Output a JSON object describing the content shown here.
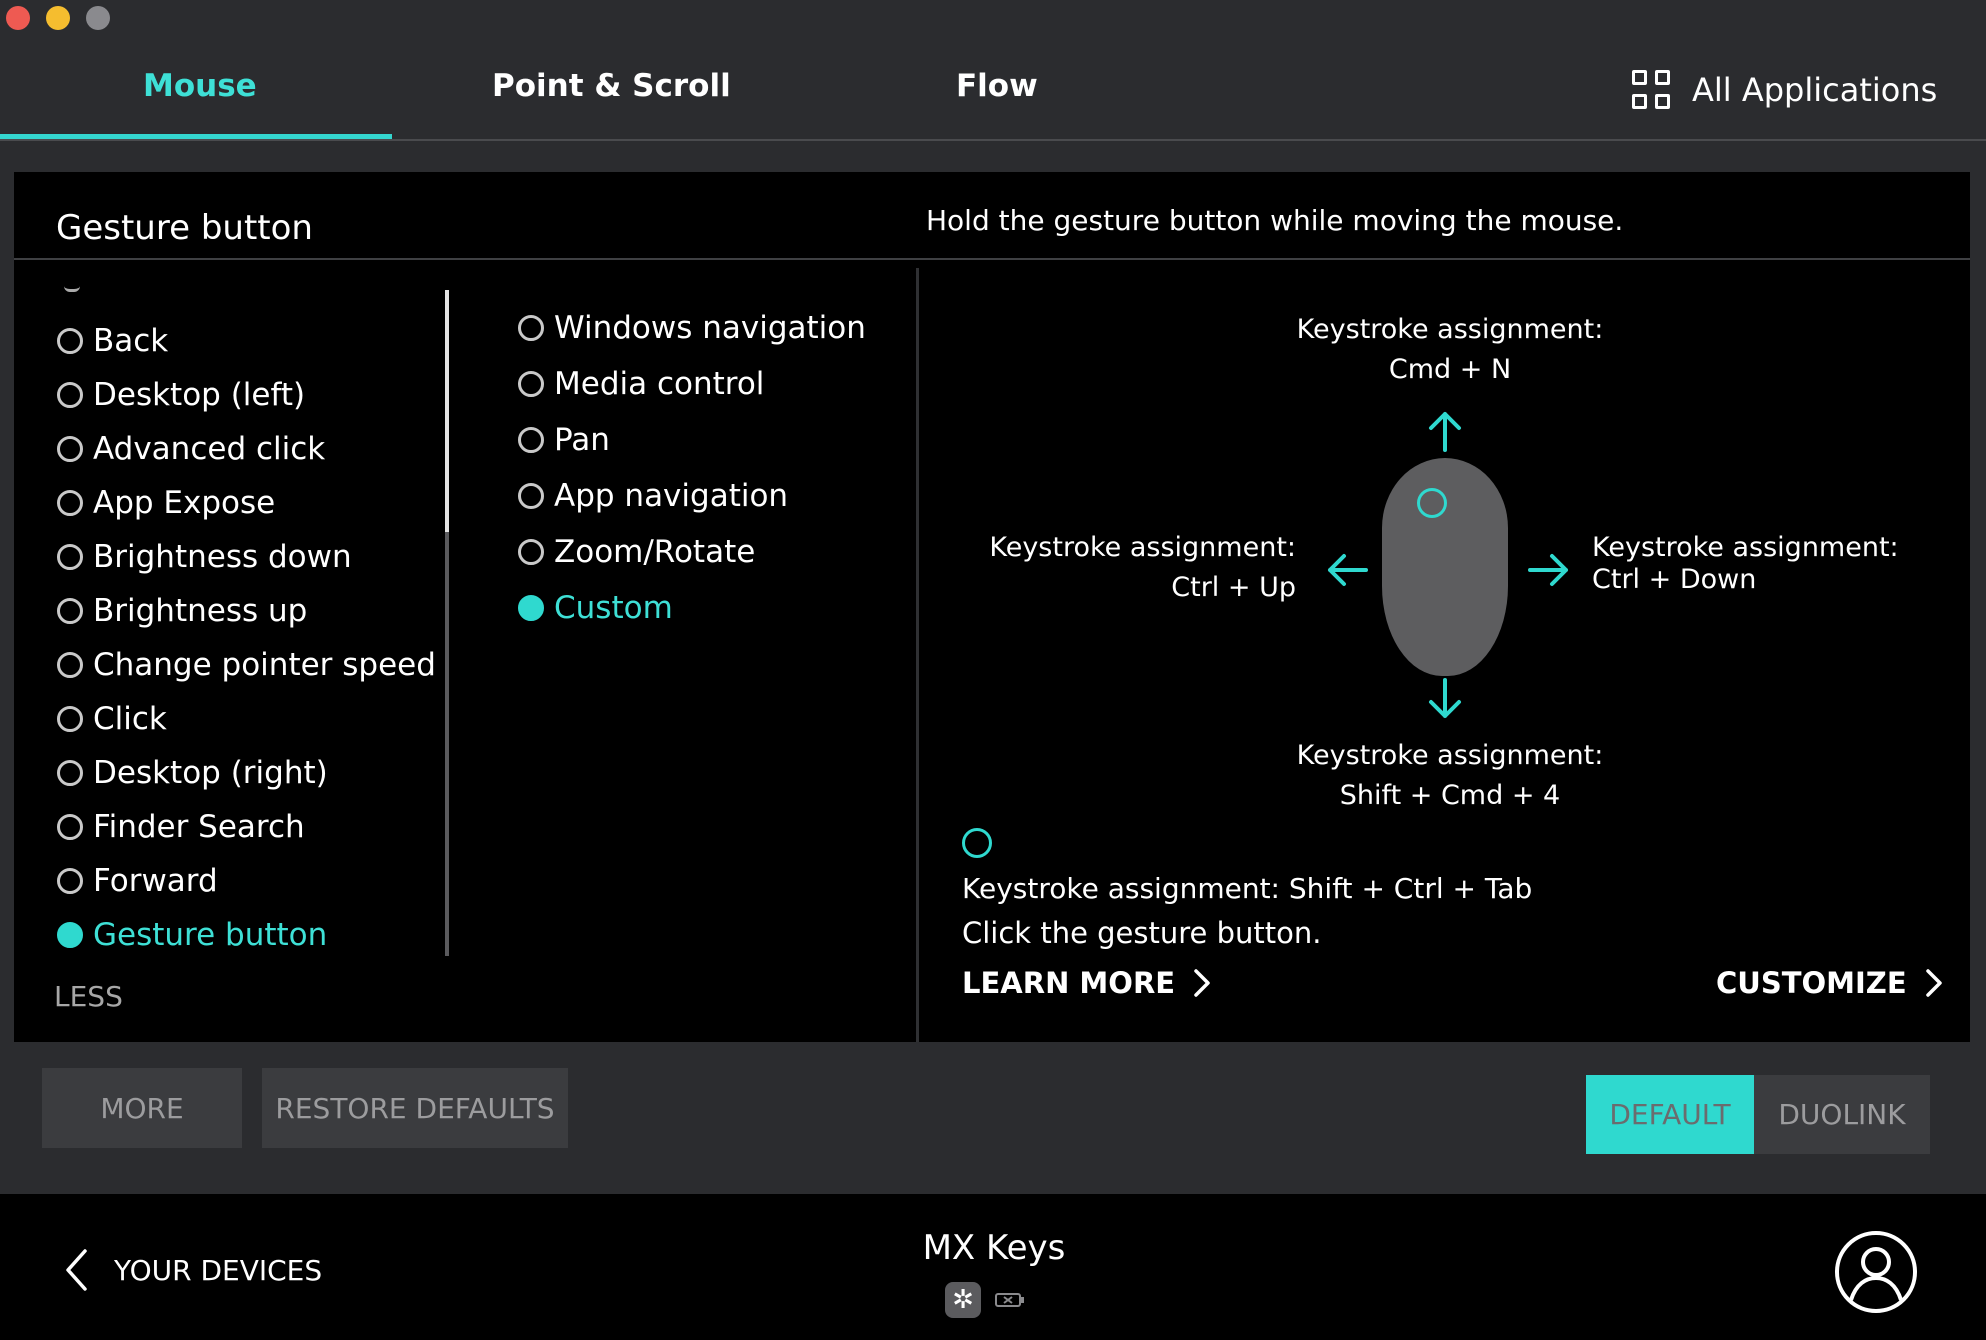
{
  "tabs": [
    {
      "label": "Mouse",
      "active": true
    },
    {
      "label": "Point & Scroll",
      "active": false
    },
    {
      "label": "Flow",
      "active": false
    }
  ],
  "all_applications": {
    "label": "All Applications",
    "icon": "grid-icon"
  },
  "panel": {
    "title": "Gesture button",
    "description": "Hold the gesture button while moving the mouse."
  },
  "button_list": {
    "items": [
      {
        "label": "Back",
        "selected": false
      },
      {
        "label": "Desktop (left)",
        "selected": false
      },
      {
        "label": "Advanced click",
        "selected": false
      },
      {
        "label": "App Expose",
        "selected": false
      },
      {
        "label": "Brightness down",
        "selected": false
      },
      {
        "label": "Brightness up",
        "selected": false
      },
      {
        "label": "Change pointer speed",
        "selected": false
      },
      {
        "label": "Click",
        "selected": false
      },
      {
        "label": "Desktop (right)",
        "selected": false
      },
      {
        "label": "Finder Search",
        "selected": false
      },
      {
        "label": "Forward",
        "selected": false
      },
      {
        "label": "Gesture button",
        "selected": true
      }
    ],
    "less_label": "LESS"
  },
  "gesture_modes": {
    "items": [
      {
        "label": "Windows navigation",
        "selected": false
      },
      {
        "label": "Media control",
        "selected": false
      },
      {
        "label": "Pan",
        "selected": false
      },
      {
        "label": "App navigation",
        "selected": false
      },
      {
        "label": "Zoom/Rotate",
        "selected": false
      },
      {
        "label": "Custom",
        "selected": true
      }
    ]
  },
  "diagram": {
    "up": {
      "title": "Keystroke assignment:",
      "value": "Cmd + N"
    },
    "left": {
      "title": "Keystroke assignment:",
      "value": "Ctrl + Up"
    },
    "right": {
      "title": "Keystroke assignment:",
      "value": "Ctrl + Down"
    },
    "down": {
      "title": "Keystroke assignment:",
      "value": "Shift + Cmd + 4"
    },
    "click_assignment": "Keystroke assignment: Shift + Ctrl + Tab",
    "click_instruction": "Click the gesture button.",
    "learn_more": "LEARN MORE",
    "customize": "CUSTOMIZE",
    "accent_color": "#2fd9cf"
  },
  "actions": {
    "more": "MORE",
    "restore_defaults": "RESTORE DEFAULTS",
    "default": "DEFAULT",
    "duolink": "DUOLINK"
  },
  "footer": {
    "back_label": "YOUR DEVICES",
    "device_name": "MX Keys",
    "icons": [
      "bluetooth-icon",
      "battery-icon",
      "profile-icon"
    ]
  }
}
